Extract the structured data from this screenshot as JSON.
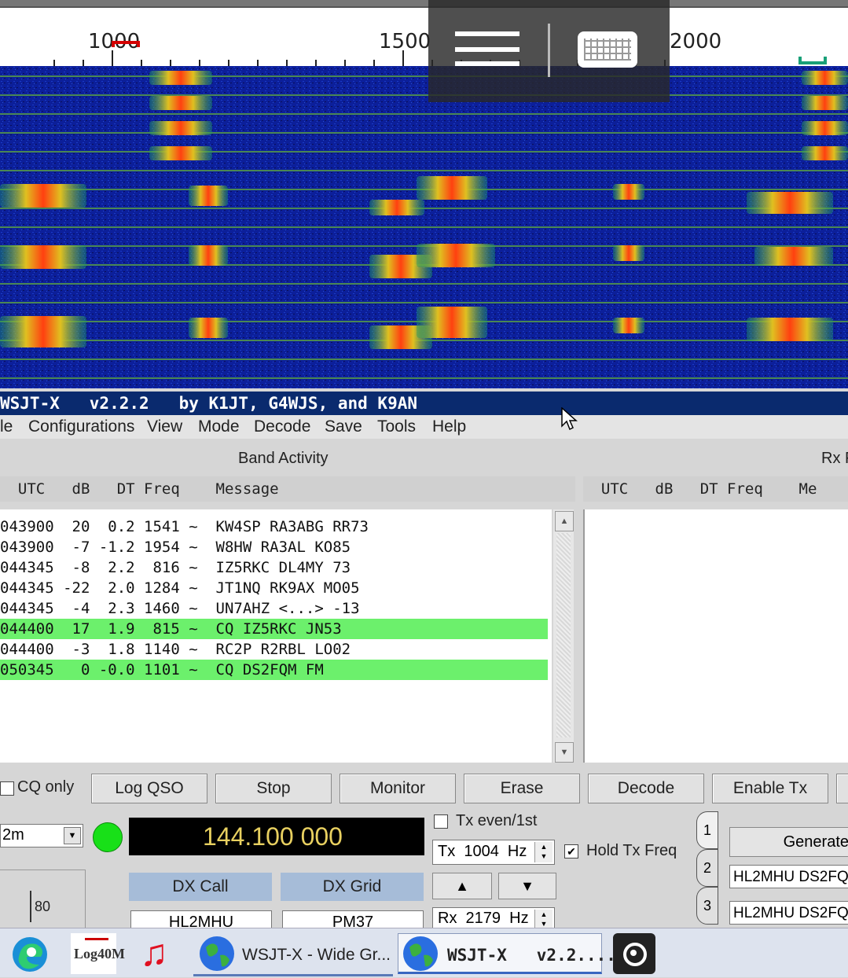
{
  "waterfall": {
    "freq_labels": [
      "1000",
      "1500",
      "2000"
    ]
  },
  "overlay": {
    "menu_icon": "hamburger-icon",
    "keyboard_icon": "keyboard-icon"
  },
  "window": {
    "title": "WSJT-X   v2.2.2   by K1JT, G4WJS, and K9AN"
  },
  "menu": [
    "le",
    "Configurations",
    "View",
    "Mode",
    "Decode",
    "Save",
    "Tools",
    "Help"
  ],
  "band_activity": {
    "title": "Band Activity",
    "header": "  UTC   dB   DT Freq    Message",
    "rows": [
      {
        "text": "043900  20  0.2 1541 ~  KW4SP RA3ABG RR73",
        "highlight": false
      },
      {
        "text": "043900  -7 -1.2 1954 ~  W8HW RA3AL KO85",
        "highlight": false
      },
      {
        "text": "044345  -8  2.2  816 ~  IZ5RKC DL4MY 73",
        "highlight": false
      },
      {
        "text": "044345 -22  2.0 1284 ~  JT1NQ RK9AX MO05",
        "highlight": false
      },
      {
        "text": "044345  -4  2.3 1460 ~  UN7AHZ <...> -13",
        "highlight": false
      },
      {
        "text": "044400  17  1.9  815 ~  CQ IZ5RKC JN53",
        "highlight": true
      },
      {
        "text": "044400  -3  1.8 1140 ~  RC2P R2RBL LO02",
        "highlight": false
      },
      {
        "text": "050345   0 -0.0 1101 ~  CQ DS2FQM FM",
        "highlight": true
      }
    ]
  },
  "rx_frequency": {
    "title": "Rx F",
    "header": "  UTC   dB   DT Freq    Me"
  },
  "controls": {
    "cq_only": "CQ only",
    "buttons": [
      "Log QSO",
      "Stop",
      "Monitor",
      "Erase",
      "Decode",
      "Enable Tx"
    ],
    "band": "2m",
    "frequency": "144.100 000",
    "tx_even": "Tx even/1st",
    "tx_freq": "Tx  1004  Hz",
    "hold_tx": "Hold Tx Freq",
    "rx_freq": "Rx  2179  Hz",
    "dx_call_label": "DX Call",
    "dx_grid_label": "DX Grid",
    "dx_call": "HL2MHU",
    "dx_grid": "PM37",
    "level": "80",
    "generate": "Generate",
    "tx_msg1": "HL2MHU DS2FQ",
    "tx_msg2": "HL2MHU DS2FQ",
    "tabs": [
      "1",
      "2",
      "3"
    ]
  },
  "taskbar": {
    "items": [
      {
        "icon": "edge-icon"
      },
      {
        "icon": "log40m-icon",
        "text": "Log40M"
      },
      {
        "icon": "music-icon"
      },
      {
        "icon": "globe-icon",
        "text": "WSJT-X - Wide Gr..."
      },
      {
        "icon": "globe-icon",
        "text": "WSJT-X   v2.2...."
      },
      {
        "icon": "camera-icon"
      }
    ]
  }
}
